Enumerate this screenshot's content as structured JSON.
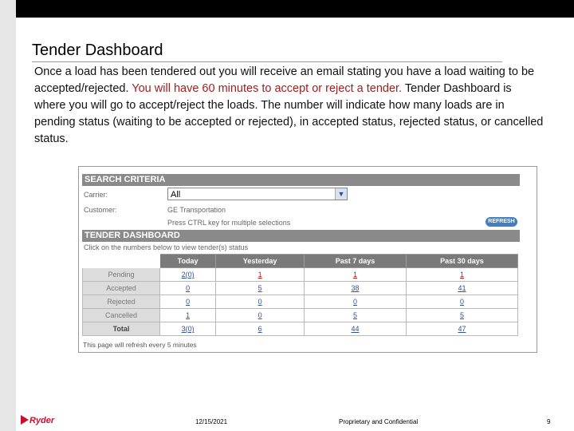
{
  "slide": {
    "title": "Tender Dashboard",
    "para_1": "Once a load has been tendered out you will receive an email stating you have a load waiting to be accepted/rejected.",
    "para_red": "You will have 60 minutes to accept or reject a tender.",
    "para_2": "Tender Dashboard is where you will go to accept/reject the loads. The number will indicate how many loads are in pending status (waiting to be accepted or rejected), in accepted status, rejected status, or cancelled status."
  },
  "search_criteria": {
    "header": "SEARCH CRITERIA",
    "carrier_label": "Carrier:",
    "carrier_value": "All",
    "customer_label": "Customer:",
    "customer_value": "GE Transportation",
    "hint": "Press CTRL key for multiple selections",
    "refresh_label": "REFRESH"
  },
  "dashboard": {
    "header": "TENDER DASHBOARD",
    "instruction": "Click on the numbers below to view tender(s) status",
    "columns": [
      "Today",
      "Yesterday",
      "Past 7 days",
      "Past 30 days"
    ],
    "rows": [
      {
        "label": "Pending",
        "today": "2(0)",
        "yesterday": "1",
        "past7": "1",
        "past30": "1"
      },
      {
        "label": "Accepted",
        "today": "0",
        "yesterday": "5",
        "past7": "38",
        "past30": "41"
      },
      {
        "label": "Rejected",
        "today": "0",
        "yesterday": "0",
        "past7": "0",
        "past30": "0"
      },
      {
        "label": "Cancelled",
        "today": "1",
        "yesterday": "0",
        "past7": "5",
        "past30": "5"
      },
      {
        "label": "Total",
        "today": "3(0)",
        "yesterday": "6",
        "past7": "44",
        "past30": "47"
      }
    ],
    "refresh_note": "This page will refresh every 5 minutes"
  },
  "footer": {
    "logo_text": "Ryder",
    "date": "12/15/2021",
    "confidential": "Proprietary and Confidential",
    "page": "9"
  },
  "colors": {
    "header_gray": "#8a8a8a",
    "link_blue": "#2f4f9c",
    "pending_red": "#c41616",
    "ryder_red": "#c8102e"
  }
}
